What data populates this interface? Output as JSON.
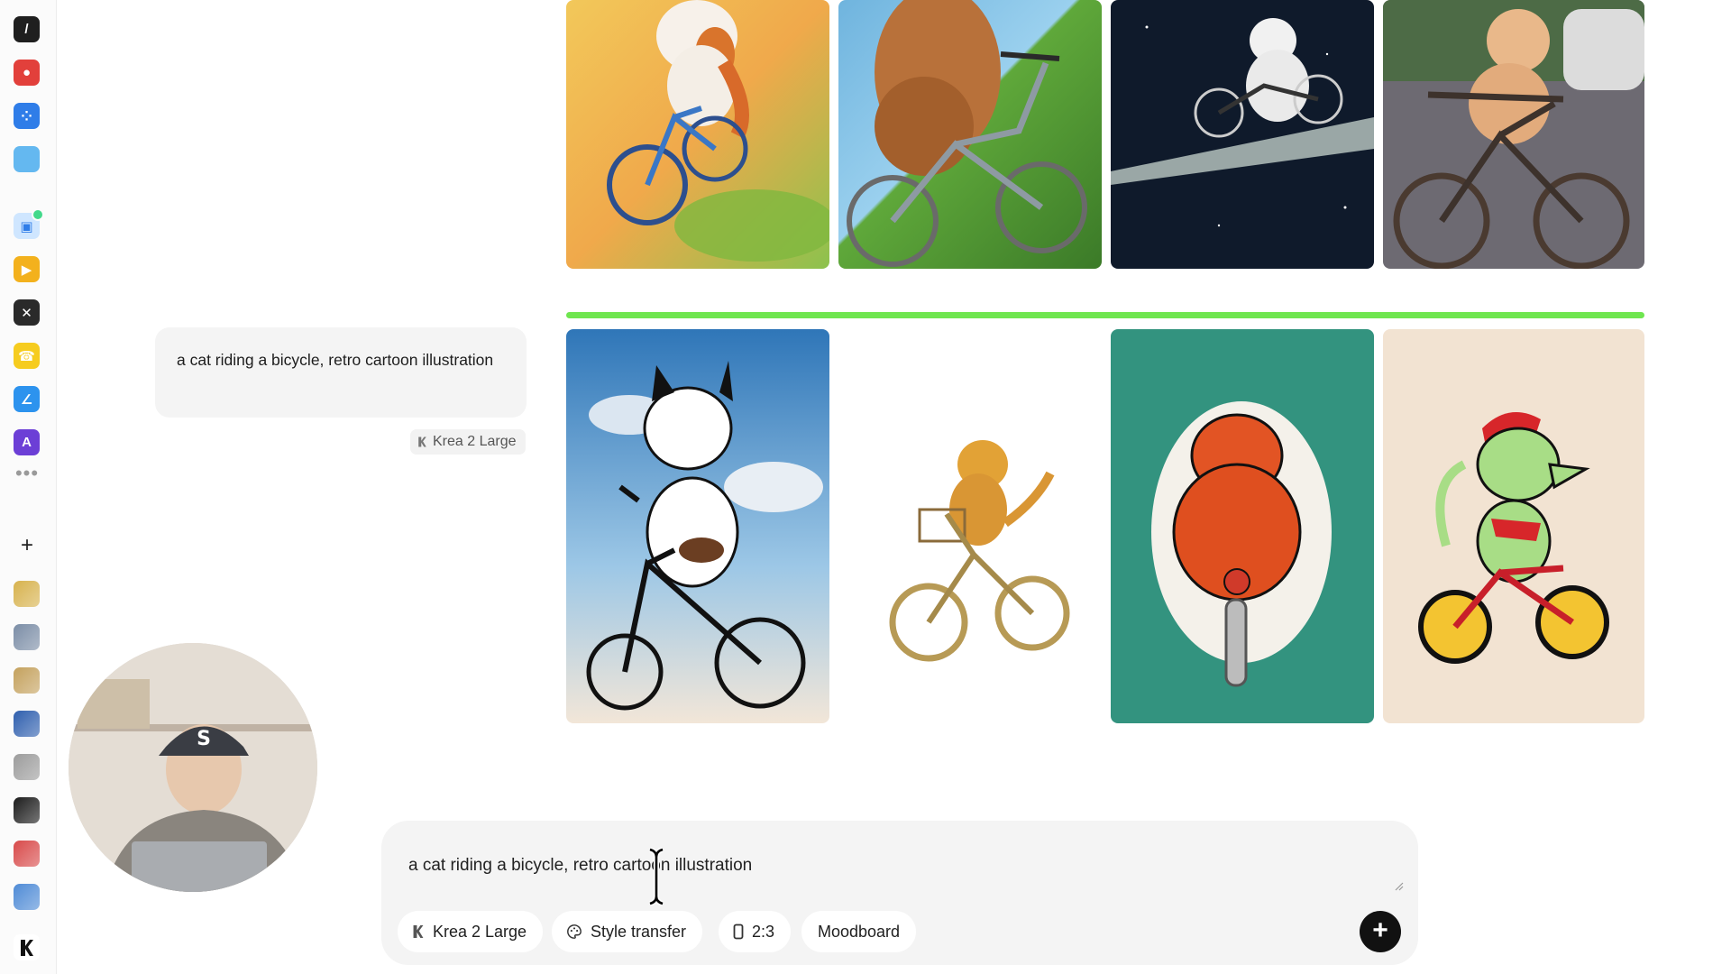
{
  "sidebar": {
    "apps": [
      {
        "name": "pen-tool-app-icon",
        "color": "#1f1f1f",
        "glyph": "/"
      },
      {
        "name": "color-wheel-app-icon",
        "color": "#e2403b",
        "glyph": "●"
      },
      {
        "name": "nodes-app-icon",
        "color": "#2f7de8",
        "glyph": "⁘"
      },
      {
        "name": "folder-app-icon",
        "color": "#64b8f0",
        "glyph": ""
      },
      {
        "name": "image-gallery-app-icon",
        "color": "#cfe6ff",
        "glyph": "▣"
      },
      {
        "name": "video-app-icon",
        "color": "#f3b11d",
        "glyph": "▶"
      },
      {
        "name": "tools-app-icon",
        "color": "#2a2a2a",
        "glyph": "✕"
      },
      {
        "name": "phone-app-icon",
        "color": "#f6cc1f",
        "glyph": "☎"
      },
      {
        "name": "brush-app-icon",
        "color": "#2d93ee",
        "glyph": "∠"
      },
      {
        "name": "type-app-icon",
        "color": "#6c3fd6",
        "glyph": "A"
      }
    ],
    "recent_thumbs": [
      "#d7b24d",
      "#7b8da6",
      "#c4a15d",
      "#2f5fae",
      "#9c9c9c",
      "#1c1c1c",
      "#d84a4a",
      "#4f8bd6"
    ],
    "more_label": "•••",
    "add_label": "+"
  },
  "chat": {
    "prompt_text": "a cat riding a bicycle, retro cartoon illustration",
    "model_label": "Krea 2 Large"
  },
  "composer": {
    "input_value": "a cat riding a bicycle, retro cartoon illustration",
    "model_button": "Krea 2 Large",
    "style_button": "Style transfer",
    "aspect_button": "2:3",
    "moodboard_button": "Moodboard",
    "send_label": "+"
  },
  "colors": {
    "accent_progress": "#6fe64f",
    "bubble_bg": "#f4f4f4",
    "send_bg": "#111111"
  }
}
